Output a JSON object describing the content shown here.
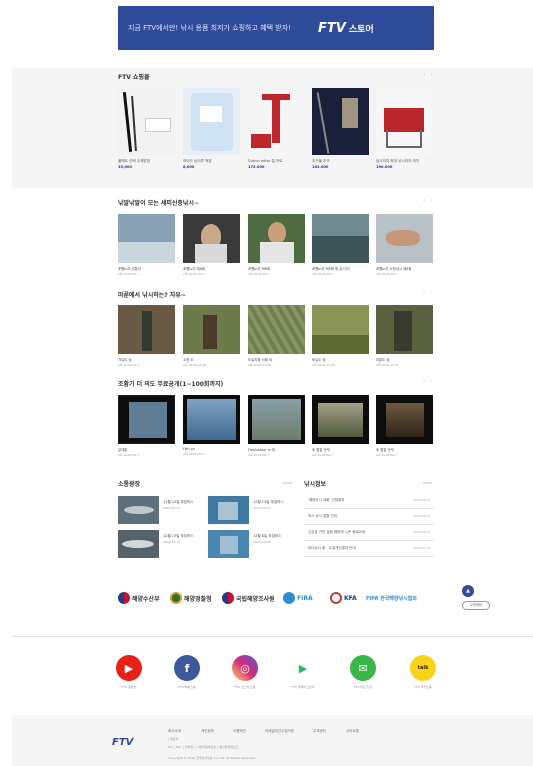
{
  "banner": {
    "text": "지금 FTV에서만! 낚시 용품 최저가 쇼핑하고 혜택 받자!",
    "logo": "FTV",
    "store": "스토어"
  },
  "shop": {
    "title": "FTV 쇼핑몰",
    "arrows": "‹ ›",
    "items": [
      {
        "name": "플래트 선택 수제받침",
        "price": "35,000"
      },
      {
        "name": "하이드 숭어루 떡밥",
        "price": "8,000"
      },
      {
        "name": "Dubon edfor 릴 카트",
        "price": "172,000"
      },
      {
        "name": "조구물 조구",
        "price": "162,000"
      },
      {
        "name": "낚시의자 좌대 낚시의자 의자",
        "price": "190,000"
      }
    ]
  },
  "videos1": {
    "title": "낚알낚알이 모는 세피신충낚시~",
    "arrows": "‹ ›",
    "items": [
      {
        "t": "조행노리 전통지",
        "m": "2회 2019.08.7"
      },
      {
        "t": "조행노리 제8회",
        "m": "2회 2019.08.7"
      },
      {
        "t": "조행노리 제6회",
        "m": "2회 2019.08.7"
      },
      {
        "t": "조행노리 제5화 청 숭 다리",
        "m": "2회 2019.08.7"
      },
      {
        "t": "조행노리 노란낚시 제4회",
        "m": "2회 2019.08.7"
      }
    ]
  },
  "videos2": {
    "title": "마룬에서 낚시하는? 자유~",
    "arrows": "‹ ›",
    "items": [
      {
        "t": "가유도 상",
        "m": "2회 2019.04.0"
      },
      {
        "t": "소청 도",
        "m": "2회 2019.04.06"
      },
      {
        "t": "도유지점 서해 낚",
        "m": "2회 2019.03.28"
      },
      {
        "t": "등유도 상",
        "m": "2회 2019.03.28"
      },
      {
        "t": "마룬도 상",
        "m": "2회 2019.02.27"
      }
    ]
  },
  "videos3": {
    "title": "조황기 더 의도 무료공개(1~100회까지)",
    "arrows": "‹ ›",
    "items": [
      {
        "t": "갈대밭",
        "m": "2회 2019.08.7"
      },
      {
        "t": "Fish on",
        "m": "2회 2019.08.7"
      },
      {
        "t": "Freshwater in 대",
        "m": "2회 2019.08.7"
      },
      {
        "t": "조 월질 산악",
        "m": "2회 2019.08.7"
      },
      {
        "t": "조 월질 산악",
        "m": "2회 2019.08.7"
      }
    ]
  },
  "shop_news": {
    "title": "소통광장",
    "more": "more",
    "items": [
      {
        "t": "12월 14일 푸짐하스",
        "d": "2020.12.14"
      },
      {
        "t": "12월 14일 푸짐하스",
        "d": "2020.12.13"
      },
      {
        "t": "12월 13일 푸짐하스",
        "d": "2020.12.11"
      },
      {
        "t": "12월 8일 푸짐하스",
        "d": "2020.12.08"
      }
    ]
  },
  "fishing_news": {
    "title": "낚시정보",
    "more": "more",
    "items": [
      {
        "t": "'해양낚시 대회' 선정결과",
        "d": "2020.04.03"
      },
      {
        "t": "보스 낚시 통합 관리",
        "d": "2020.03.27"
      },
      {
        "t": "긴급호 거짓 설정 때문에 시즌 종료요청",
        "d": "2020.03.05"
      },
      {
        "t": "바다낚시 중 - 수질개선결과 안내",
        "d": "2020.02.20"
      }
    ]
  },
  "partners": [
    {
      "name": "해양수산부",
      "color": "#1e3c8c"
    },
    {
      "name": "해양경찰청",
      "color": "#2b6f3a"
    },
    {
      "name": "국립해양조사원",
      "color": "#1e3c8c"
    },
    {
      "name": "FIRA",
      "color": "#2b8fd1"
    },
    {
      "name": "KFA",
      "color": "#c23a3a"
    },
    {
      "name": "FIPA 한국해양낚시협회",
      "color": "#2b8fd1"
    }
  ],
  "side": {
    "top_label": "▲",
    "phone_label": "고객센터"
  },
  "social": [
    {
      "label": "FTV 유튜브",
      "color": "#e62117",
      "glyph": "▶"
    },
    {
      "label": "FTV 페이스북",
      "color": "#3b5998",
      "glyph": "f"
    },
    {
      "label": "FTV 인스타그램",
      "color": "#d6249f",
      "glyph": "◎"
    },
    {
      "label": "FTV 플레이스토어",
      "color": "#ffffff",
      "glyph": "▶"
    },
    {
      "label": "FTV 라인 친구",
      "color": "#3ab54a",
      "glyph": "✉"
    },
    {
      "label": "FTV 카카오톡",
      "color": "#f7d417",
      "glyph": "talk"
    }
  ],
  "footer": {
    "logo": "FTV",
    "links": [
      "회사소개",
      "개인정보",
      "이용약관",
      "이메일무단수집거부",
      "고객센터",
      "사이트맵"
    ],
    "addr1": "Tel. | Fax. | 이메일. | 사업자등록번호 | 통신판매업신고",
    "addr2": "| 대표자 :",
    "copy": "Copyright © 2019 한국낚시방송 Co.,Ltd. All Rights Reserved."
  }
}
